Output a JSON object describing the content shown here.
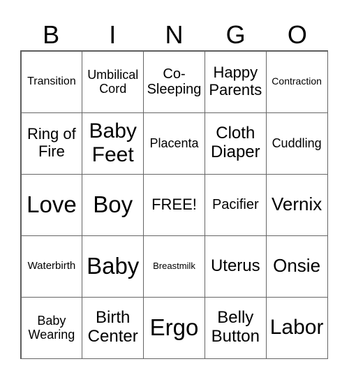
{
  "header": {
    "letters": [
      "B",
      "I",
      "N",
      "G",
      "O"
    ]
  },
  "grid": {
    "rows": [
      [
        "Transition",
        "Umbilical Cord",
        "Co-Sleeping",
        "Happy Parents",
        "Contraction"
      ],
      [
        "Ring of Fire",
        "Baby Feet",
        "Placenta",
        "Cloth Diaper",
        "Cuddling"
      ],
      [
        "Love",
        "Boy",
        "FREE!",
        "Pacifier",
        "Vernix"
      ],
      [
        "Waterbirth",
        "Baby",
        "Breastmilk",
        "Uterus",
        "Onsie"
      ],
      [
        "Baby Wearing",
        "Birth Center",
        "Ergo",
        "Belly Button",
        "Labor"
      ]
    ]
  }
}
